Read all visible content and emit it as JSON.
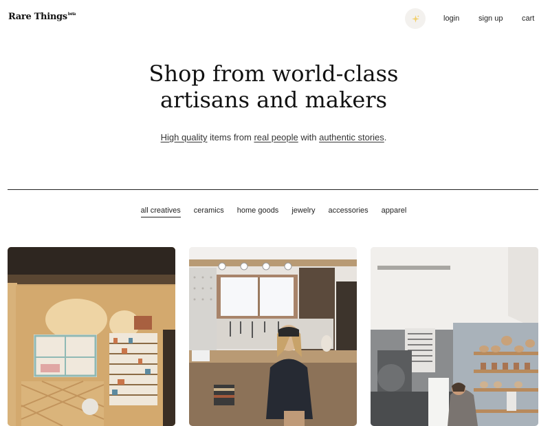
{
  "header": {
    "logo": "Rare Things",
    "logo_badge": "beta",
    "spark_icon": "sparkles-icon",
    "nav": {
      "login": "login",
      "signup": "sign up",
      "cart": "cart"
    }
  },
  "hero": {
    "title_line1": "Shop from world-class",
    "title_line2": "artisans and makers",
    "sub": {
      "part1": "High quality",
      "part2": " items from ",
      "part3": "real people",
      "part4": " with ",
      "part5": "authentic stories",
      "part6": "."
    }
  },
  "filters": [
    "all creatives",
    "ceramics",
    "home goods",
    "jewelry",
    "accessories",
    "apparel"
  ],
  "active_filter": "all creatives",
  "cards": [
    {
      "alt": "Woodworking studio interior"
    },
    {
      "alt": "Maker working at a workbench"
    },
    {
      "alt": "Ceramics studio with shelves of pots"
    }
  ],
  "colors": {
    "text": "#111111",
    "spark_bg": "#f3f1ee",
    "spark": "#f2cf6b"
  }
}
